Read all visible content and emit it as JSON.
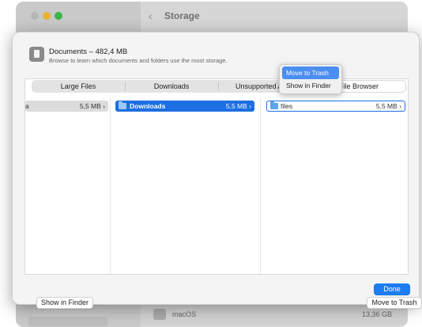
{
  "background": {
    "title": "Storage",
    "row_label": "macOS",
    "row_size": "13,36 GB"
  },
  "sheet": {
    "doc_title": "Documents – 482,4 MB",
    "doc_subtitle": "Browse to learn which documents and folders use the most storage.",
    "tabs": [
      "Large Files",
      "Downloads",
      "Unsupported Apps",
      "File Browser"
    ],
    "active_tab": "File Browser",
    "columns": {
      "col1": {
        "name": "a",
        "size": "5,5 MB ›"
      },
      "col2": {
        "name": "Downloads",
        "size": "5,5 MB ›"
      },
      "col3": {
        "name": "files",
        "size": "5,5 MB ›"
      }
    },
    "context_menu": {
      "items": [
        "Move to Trash",
        "Show in Finder"
      ]
    },
    "buttons": {
      "show_in_finder": "Show in Finder",
      "move_to_trash": "Move to Trash",
      "done": "Done"
    }
  },
  "colors": {
    "accent": "#1d6fe2",
    "done_button": "#1d7cf2"
  }
}
